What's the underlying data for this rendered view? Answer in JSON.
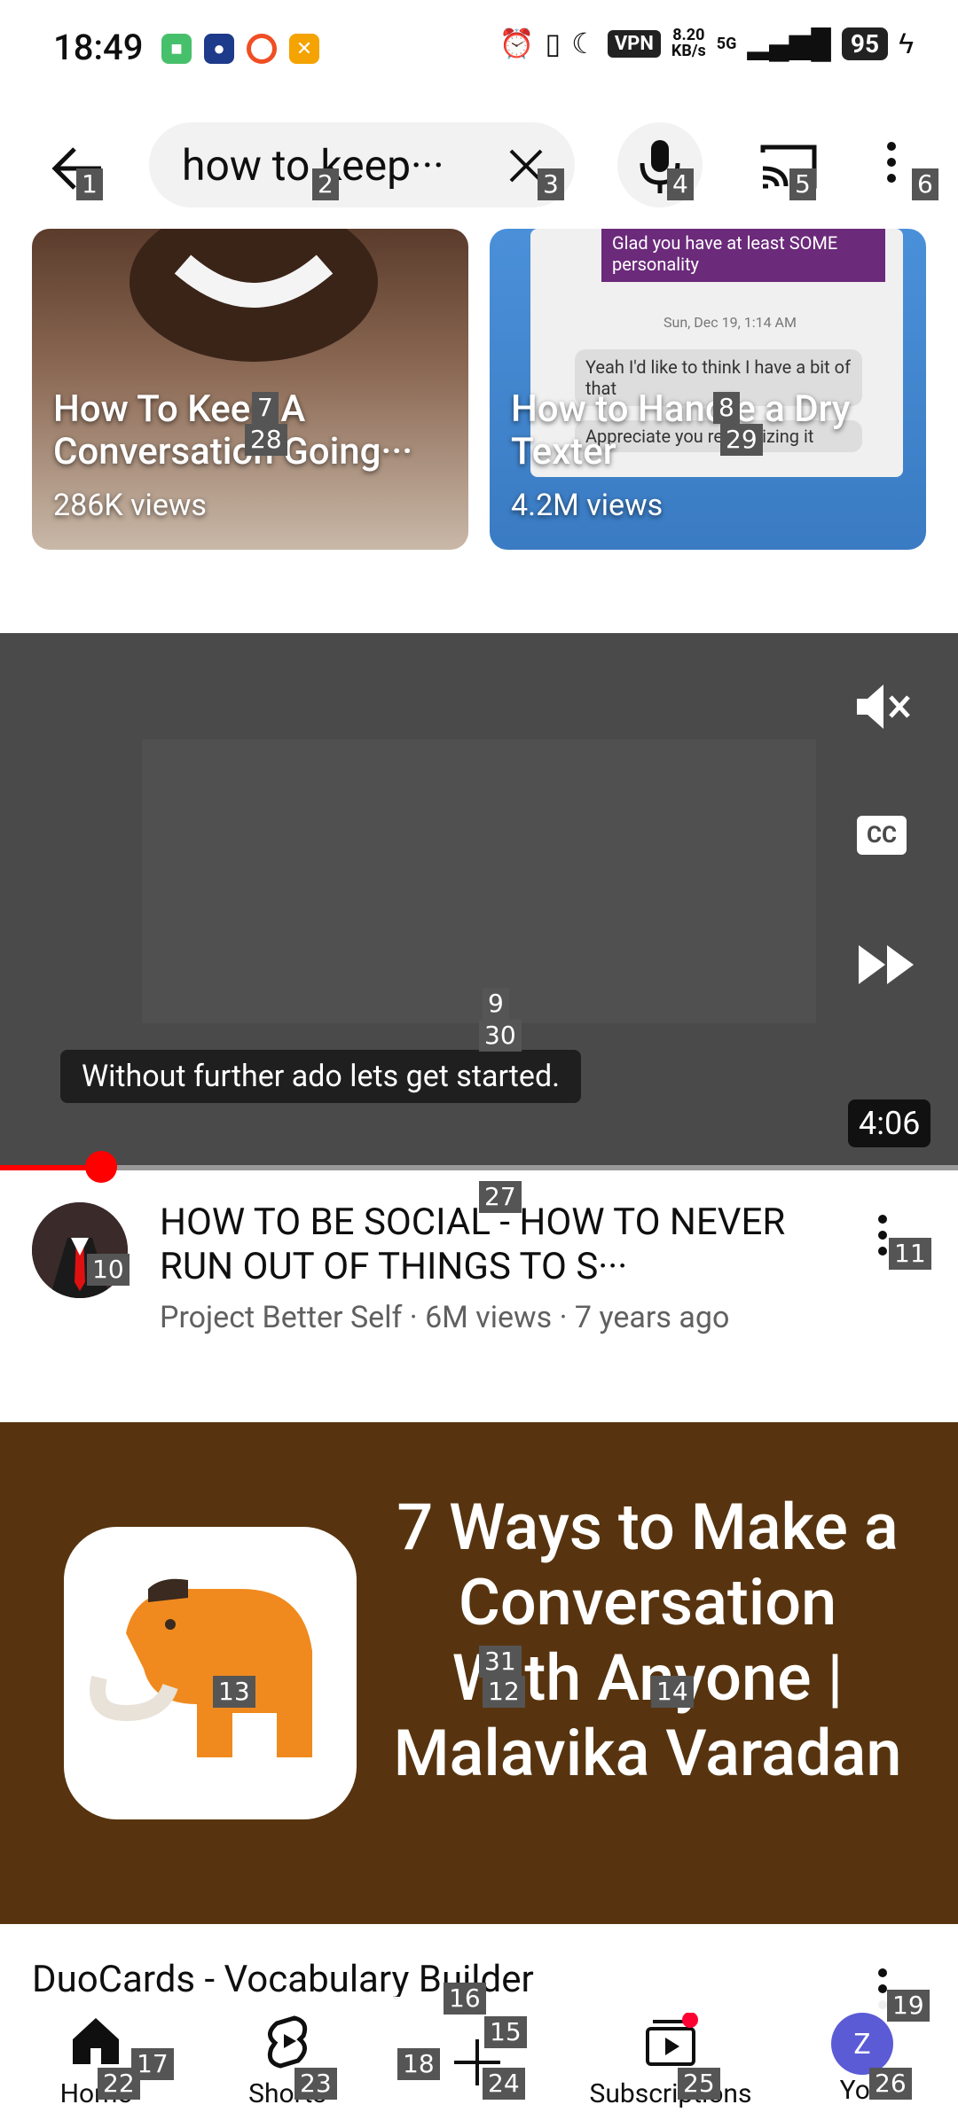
{
  "status_bar": {
    "time": "18:49",
    "net_speed": "8.20",
    "net_unit": "KB/s",
    "network": "5G",
    "battery": "95",
    "vpn": "VPN"
  },
  "search": {
    "query": "how to keep···"
  },
  "shelf": [
    {
      "title": "How To Keep A Conversation Going···",
      "views": "286K views"
    },
    {
      "title": "How to Handle a Dry Texter",
      "views": "4.2M views",
      "chat_header": "Glad you have at least SOME personality",
      "chat_date": "Sun, Dec 19, 1:14 AM",
      "chat_msg1": "Yeah I'd like to think I have a bit of that",
      "chat_msg2": "Appreciate you recognizing it"
    }
  ],
  "player": {
    "caption": "Without further ado lets get started.",
    "duration": "4:06",
    "progress_fraction": 0.1,
    "cc_label": "CC"
  },
  "video": {
    "title": "HOW TO BE SOCIAL - HOW TO NEVER RUN OUT OF THINGS TO S···",
    "channel": "Project Better Self",
    "views": "6M views",
    "age": "7 years ago",
    "separator": "·"
  },
  "ad": {
    "headline": "7 Ways to Make a Conversation With Anyone | Malavika Varadan",
    "sponsor": "DuoCards - Vocabulary Builder"
  },
  "nav": {
    "home": "Home",
    "shorts": "Shorts",
    "subscriptions": "Subscriptions",
    "you": "You",
    "avatar_letter": "Z"
  },
  "markers": [
    "1",
    "2",
    "3",
    "4",
    "5",
    "6",
    "7",
    "8",
    "9",
    "10",
    "11",
    "12",
    "13",
    "14",
    "15",
    "16",
    "17",
    "18",
    "19",
    "22",
    "23",
    "24",
    "25",
    "26",
    "27",
    "28",
    "29",
    "30",
    "31"
  ],
  "colors": {
    "accent_red": "#ff0000",
    "ad_brown": "#57340f",
    "player_gray": "#4a4a4a",
    "avatar_purple": "#5b5bd6"
  }
}
